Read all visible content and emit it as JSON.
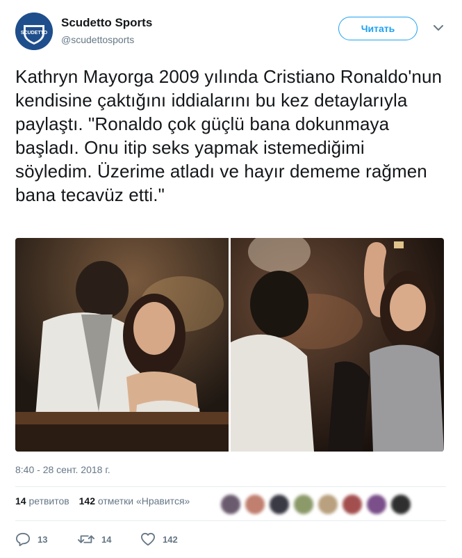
{
  "author": {
    "name": "Scudetto Sports",
    "handle": "@scudettosports",
    "avatar_text": "SCUDETTO"
  },
  "follow_button": {
    "label": "Читать"
  },
  "tweet": {
    "text": "Kathryn Mayorga 2009 yılında Cristiano Ronaldo'nun kendisine çaktığını iddialarını bu kez detaylarıyla paylaştı. \"Ronaldo çok güçlü bana dokunmaya başladı. Onu itip seks yapmak istemediğimi söyledim. Üzerime atladı ve hayır dememe rağmen bana tecavüz etti.\"",
    "timestamp": "8:40 - 28 сент. 2018 г."
  },
  "media": {
    "photo_count": 2
  },
  "stats": {
    "retweets_count": "14",
    "retweets_label": "ретвитов",
    "likes_count": "142",
    "likes_label": "отметки «Нравится»"
  },
  "liker_faces": [
    "#6b5b6e",
    "#c07f6f",
    "#3a3a45",
    "#8c9a6a",
    "#b9a07e",
    "#a44f4f",
    "#7a4f8a",
    "#2f2f2f"
  ],
  "actions": {
    "reply_count": "13",
    "retweet_count": "14",
    "like_count": "142"
  },
  "colors": {
    "accent": "#1da1f2",
    "muted_text": "#657786",
    "brand_blue": "#1f4e8c"
  }
}
